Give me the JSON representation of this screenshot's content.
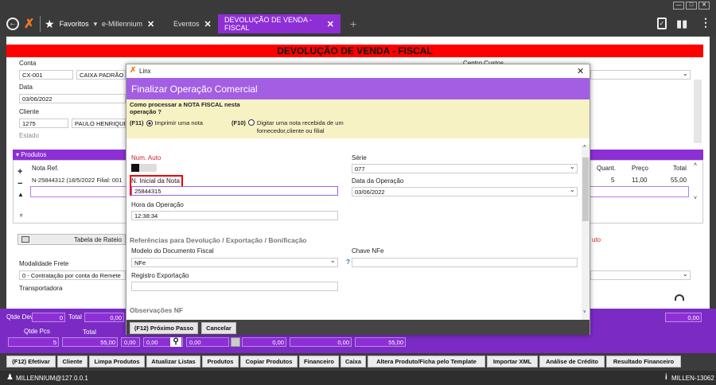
{
  "tabs": {
    "favorites": "Favoritos",
    "favorites_arrow": "▾",
    "t1": "e-Millennium",
    "t2": "Eventos",
    "t3": "DEVOLUÇÃO DE VENDA - FISCAL",
    "plus": "+"
  },
  "page": {
    "title": "DEVOLUÇÃO DE VENDA - FISCAL"
  },
  "form": {
    "conta_label": "Conta",
    "conta_code": "CX-001",
    "conta_name": "CAIXA PADRÃO C",
    "centro_custos_label": "Centro Custos",
    "data_label": "Data",
    "data_value": "03/06/2022",
    "cliente_label": "Cliente",
    "cliente_code": "1275",
    "cliente_name": "PAULO HENRIQUE",
    "estado_label": "Estado"
  },
  "produtos": {
    "header": "▾ Produtos",
    "col_nota": "Nota Ref.",
    "col_quant": "Quant.",
    "col_preco": "Preço",
    "col_total": "Total",
    "row_nota": "N-25844312 (18/5/2022 Filial: 001",
    "row_quant": "5",
    "row_preco": "11,00",
    "row_total": "55,00",
    "plus": "+",
    "minus": "−",
    "up": "▲",
    "down": "»"
  },
  "lower": {
    "rateio": "Tabela de Rateio",
    "modalidade_label": "Modalidade Frete",
    "modalidade_value": "0 - Contratação por conta do Remete",
    "transportadora_label": "Transportadora",
    "right_label": "uto"
  },
  "totals": {
    "qtde_dev_label": "Qtde Dev",
    "qtde_dev": "0",
    "total_label": "Total",
    "total_val": "0,00",
    "right_val": "0,00",
    "qtde_pcs_label": "Qtde Pcs",
    "total2_label": "Total",
    "qtde_pcs": "5",
    "total2": "55,00",
    "v3": "0,00",
    "v4": "0,00",
    "v5": "0,00",
    "v6": "0,00",
    "v7": "0,00",
    "v8": "55,00"
  },
  "actions": [
    "(F12) Efetivar",
    "Cliente",
    "Limpa Produtos",
    "Atualizar Listas",
    "Produtos",
    "Copiar Produtos",
    "Financeiro",
    "Caixa",
    "Altera Produto/Ficha pelo Template",
    "Importar XML",
    "Análise de Crédito",
    "Resultado Financeiro"
  ],
  "status": {
    "left": "MILLENNIUM@127.0.0.1",
    "right": "MILLEN-13062"
  },
  "modal": {
    "brand": "Linx",
    "close": "✕",
    "title": "Finalizar Operação Comercial",
    "question": "Como processar a NOTA FISCAL nesta operação ?",
    "opt1_key": "(F11)",
    "opt1_label": "Imprimir uma nota",
    "opt2_key": "(F10)",
    "opt2_label": "Digitar uma nota recebida de um fornecedor,cliente ou filial",
    "num_auto_label": "Num. Auto",
    "serie_label": "Série",
    "serie_value": "077",
    "n_inicial_label": "N. Inicial da Nota",
    "n_inicial_value": "25844315",
    "data_op_label": "Data da Operação",
    "data_op_value": "03/06/2022",
    "hora_label": "Hora da Operação",
    "hora_value": "12:38:34",
    "refs_title": "Referências para Devolução / Exportação / Bonificação",
    "modelo_label": "Modelo do Documento Fiscal",
    "modelo_value": "NFe",
    "chave_label": "Chave NFe",
    "registro_label": "Registro Exportação",
    "obs_title": "Observações NF",
    "next_btn": "(F12) Próximo Passo",
    "cancel_btn": "Cancelar"
  },
  "colors": {
    "purple": "#8e2fd6",
    "red": "#ff0000",
    "yellow": "#f7f2c4"
  }
}
